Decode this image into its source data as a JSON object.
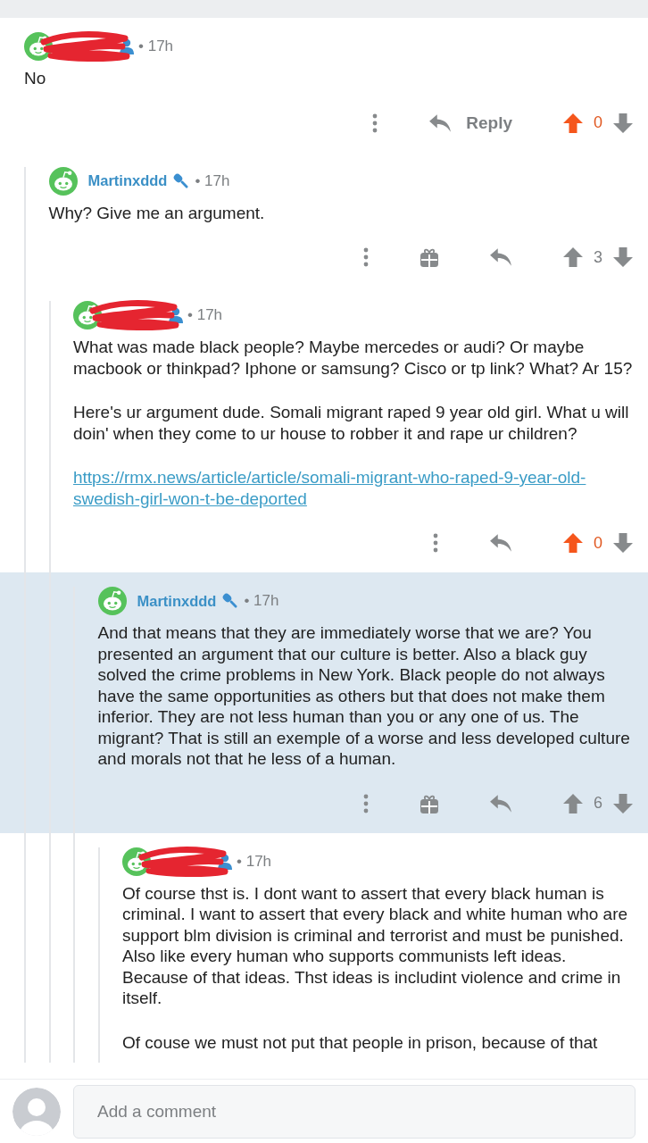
{
  "comments": [
    {
      "author_redacted": true,
      "badge": {
        "kind": "person"
      },
      "meta": "• 17h",
      "body": [
        {
          "kind": "text",
          "text": "No"
        }
      ],
      "reply_label": "Reply",
      "award_button": false,
      "upvoted": true,
      "score": "0",
      "highlighted": false,
      "children": [
        {
          "author": "Martinxddd",
          "author_redacted": false,
          "badge": {
            "kind": "mic"
          },
          "meta": "• 17h",
          "body": [
            {
              "kind": "text",
              "text": "Why? Give me an argument."
            }
          ],
          "award_button": true,
          "upvoted": false,
          "score": "3",
          "highlighted": false,
          "children": [
            {
              "author_redacted": true,
              "badge": {
                "kind": "person"
              },
              "meta": "• 17h",
              "body": [
                {
                  "kind": "text",
                  "text": "What was made black people? Maybe mercedes or audi? Or maybe macbook or thinkpad? Iphone or samsung? Cisco or tp link? What? Ar 15?"
                },
                {
                  "kind": "text",
                  "text": "Here's ur argument dude. Somali migrant raped 9 year old girl. What u will doin' when they come to ur house to robber it and rape ur children?"
                },
                {
                  "kind": "link",
                  "text": "https://rmx.news/article/article/somali-migrant-who-raped-9-year-old-swedish-girl-won-t-be-deported"
                }
              ],
              "award_button": false,
              "upvoted": true,
              "score": "0",
              "highlighted": false,
              "children": [
                {
                  "author": "Martinxddd",
                  "author_redacted": false,
                  "badge": {
                    "kind": "mic"
                  },
                  "meta": "• 17h",
                  "body": [
                    {
                      "kind": "text",
                      "text": "And that means that they are immediately worse that we are? You presented an argument that our culture is better. Also a black guy solved the crime problems in New York. Black people do not always have the same opportunities as others but that does not make them inferior. They are not less human than you or any one of us. The migrant? That is still an exemple of a worse and less developed culture and morals not that he less of a human."
                    }
                  ],
                  "award_button": true,
                  "upvoted": false,
                  "score": "6",
                  "highlighted": true,
                  "children": [
                    {
                      "author_redacted": true,
                      "badge": {
                        "kind": "person"
                      },
                      "meta": "• 17h",
                      "body": [
                        {
                          "kind": "text",
                          "text": "Of course thst is. I dont want to assert that every black human is criminal. I want to assert that every black and white human who are support blm division is criminal and terrorist and must be punished. Also like every human who supports communists left ideas. Because of that ideas. Thst ideas is includint violence and crime in itself."
                        },
                        {
                          "kind": "text",
                          "text": "Of couse we must not put that people in prison, because of that"
                        }
                      ],
                      "highlighted": false
                    }
                  ]
                }
              ]
            }
          ]
        }
      ]
    }
  ],
  "composer": {
    "placeholder": "Add a comment"
  }
}
